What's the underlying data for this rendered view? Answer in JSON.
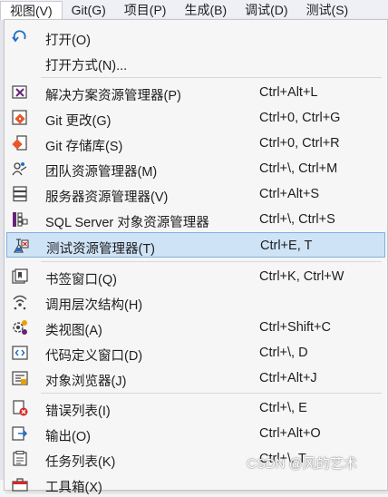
{
  "menubar": {
    "items": [
      "视图(V)",
      "Git(G)",
      "项目(P)",
      "生成(B)",
      "调试(D)",
      "测试(S)"
    ]
  },
  "menu": {
    "open": {
      "label": "打开(O)"
    },
    "open_with": {
      "label": "打开方式(N)..."
    },
    "solution_explorer": {
      "label": "解决方案资源管理器(P)",
      "shortcut": "Ctrl+Alt+L"
    },
    "git_changes": {
      "label": "Git 更改(G)",
      "shortcut": "Ctrl+0, Ctrl+G"
    },
    "git_repository": {
      "label": "Git 存储库(S)",
      "shortcut": "Ctrl+0, Ctrl+R"
    },
    "team_explorer": {
      "label": "团队资源管理器(M)",
      "shortcut": "Ctrl+\\, Ctrl+M"
    },
    "server_explorer": {
      "label": "服务器资源管理器(V)",
      "shortcut": "Ctrl+Alt+S"
    },
    "sql_server": {
      "label": "SQL Server 对象资源管理器",
      "shortcut": "Ctrl+\\, Ctrl+S"
    },
    "test_explorer": {
      "label": "测试资源管理器(T)",
      "shortcut": "Ctrl+E, T"
    },
    "bookmark": {
      "label": "书签窗口(Q)",
      "shortcut": "Ctrl+K, Ctrl+W"
    },
    "call_hierarchy": {
      "label": "调用层次结构(H)"
    },
    "class_view": {
      "label": "类视图(A)",
      "shortcut": "Ctrl+Shift+C"
    },
    "code_definition": {
      "label": "代码定义窗口(D)",
      "shortcut": "Ctrl+\\, D"
    },
    "object_browser": {
      "label": "对象浏览器(J)",
      "shortcut": "Ctrl+Alt+J"
    },
    "error_list": {
      "label": "错误列表(I)",
      "shortcut": "Ctrl+\\, E"
    },
    "output": {
      "label": "输出(O)",
      "shortcut": "Ctrl+Alt+O"
    },
    "task_list": {
      "label": "任务列表(K)",
      "shortcut": "Ctrl+\\, T"
    },
    "toolbox": {
      "label": "工具箱(X)"
    }
  },
  "watermark": "CSDN @风的艺术",
  "colors": {
    "highlight_bg": "#cfe3f7",
    "highlight_border": "#7fb0e0",
    "accent_purple": "#68217a",
    "accent_blue": "#1e6fc7",
    "git_orange": "#e8562a",
    "error_red": "#d62828"
  }
}
